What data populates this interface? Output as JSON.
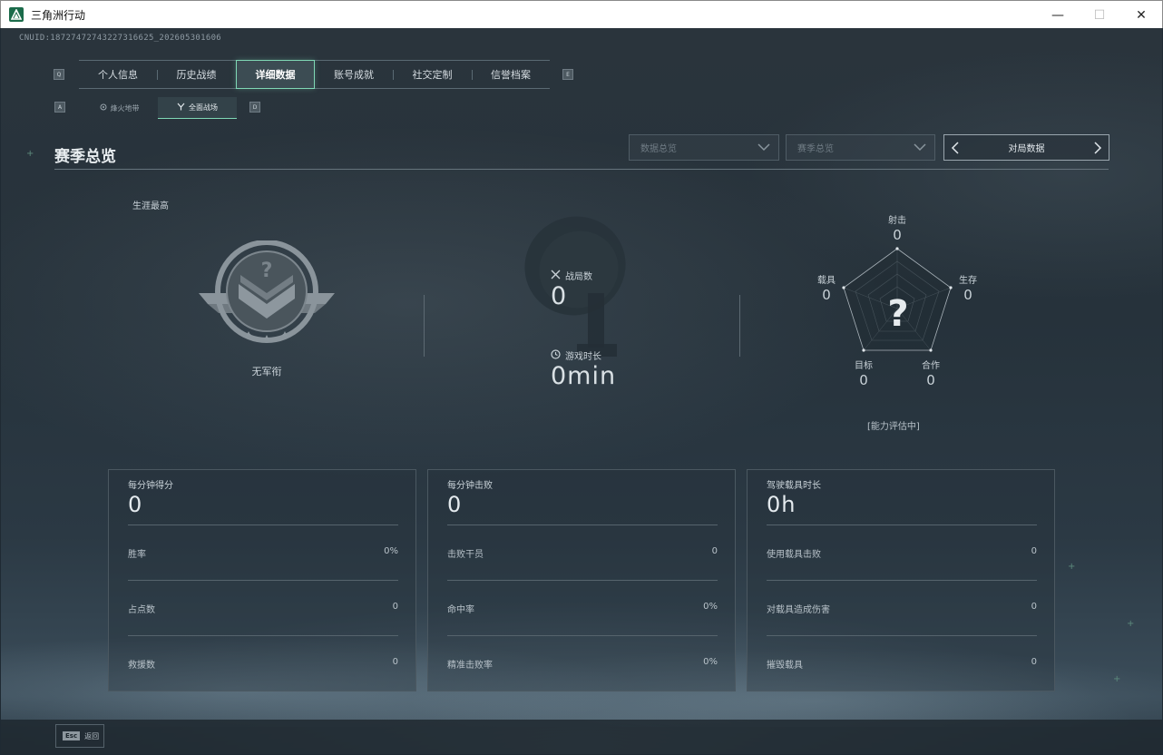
{
  "window": {
    "title": "三角洲行动",
    "minimize_glyph": "—",
    "maximize_glyph": "☐",
    "close_glyph": "✕"
  },
  "uid": "CNUID:18727472743227316625_202605301606",
  "main_tabs": {
    "left_key": "Q",
    "right_key": "E",
    "items": [
      {
        "label": "个人信息"
      },
      {
        "label": "历史战绩"
      },
      {
        "label": "详细数据",
        "active": true
      },
      {
        "label": "账号成就"
      },
      {
        "label": "社交定制"
      },
      {
        "label": "信誉档案"
      }
    ]
  },
  "sub_tabs": {
    "left_key": "A",
    "right_key": "D",
    "items": [
      {
        "label": "烽火地带",
        "icon": "flame-icon"
      },
      {
        "label": "全面战场",
        "icon": "battlefield-icon",
        "active": true
      }
    ]
  },
  "section": {
    "title": "赛季总览",
    "dropdown_data": "数据总览",
    "dropdown_season": "赛季总览",
    "pager_label": "对局数据"
  },
  "rank": {
    "career_label": "生涯最高",
    "rank_name": "无军衔"
  },
  "middle": {
    "matches_label": "战局数",
    "matches_value": "0",
    "playtime_label": "游戏时长",
    "playtime_value": "0min"
  },
  "radar": {
    "shooting_label": "射击",
    "shooting_value": "0",
    "survival_label": "生存",
    "survival_value": "0",
    "teamwork_label": "合作",
    "teamwork_value": "0",
    "objective_label": "目标",
    "objective_value": "0",
    "vehicle_label": "载具",
    "vehicle_value": "0",
    "status": "[能力评估中]",
    "values": {
      "shooting": 0,
      "survival": 0,
      "teamwork": 0,
      "objective": 0,
      "vehicle": 0
    }
  },
  "cards": [
    {
      "head": "每分钟得分",
      "big": "0",
      "rows": [
        {
          "label": "胜率",
          "value": "0%"
        },
        {
          "label": "占点数",
          "value": "0"
        },
        {
          "label": "救援数",
          "value": "0"
        }
      ]
    },
    {
      "head": "每分钟击败",
      "big": "0",
      "rows": [
        {
          "label": "击败干员",
          "value": "0"
        },
        {
          "label": "命中率",
          "value": "0%"
        },
        {
          "label": "精准击败率",
          "value": "0%"
        }
      ]
    },
    {
      "head": "驾驶载具时长",
      "big": "0h",
      "rows": [
        {
          "label": "使用载具击败",
          "value": "0"
        },
        {
          "label": "对载具造成伤害",
          "value": "0"
        },
        {
          "label": "摧毁载具",
          "value": "0"
        }
      ]
    }
  ],
  "footer": {
    "esc_key": "Esc",
    "esc_label": "返回"
  },
  "colors": {
    "accent": "#7fd8b5",
    "background": "#26323b",
    "text": "#c9d2d8"
  }
}
